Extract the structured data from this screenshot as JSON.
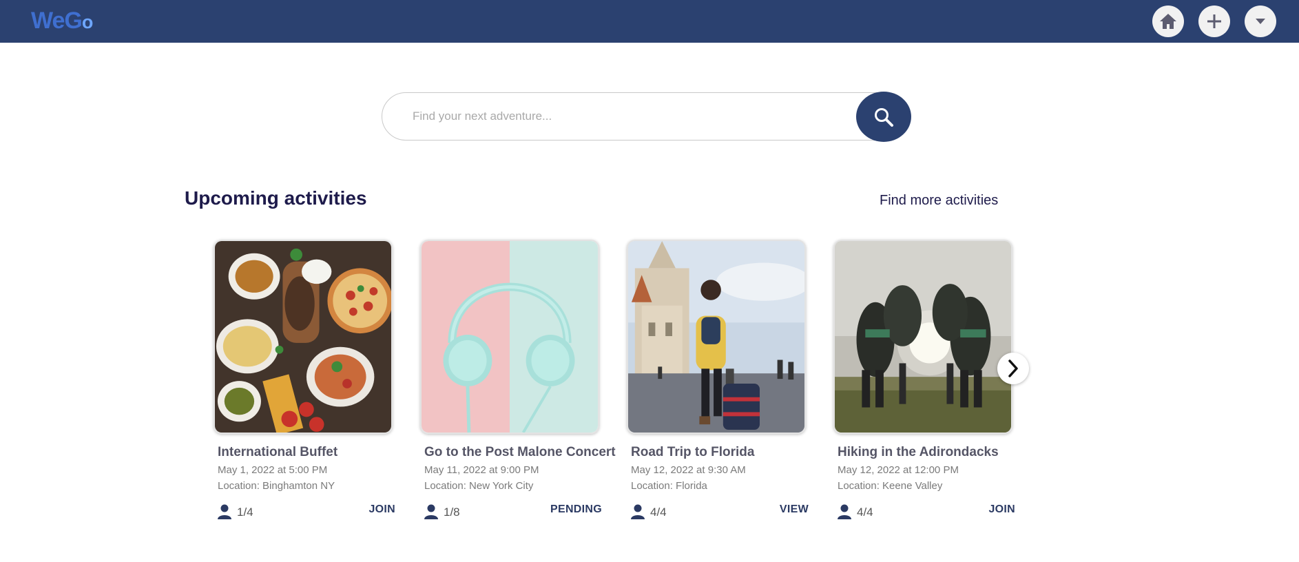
{
  "header": {
    "logo": {
      "part1": "We",
      "part2": "G",
      "part3": "o"
    },
    "home_icon": "home-icon",
    "add_icon": "plus-icon",
    "menu_icon": "caret-down-icon"
  },
  "search": {
    "placeholder": "Find your next adventure...",
    "value": "",
    "button_icon": "search-icon"
  },
  "section": {
    "title": "Upcoming activities",
    "find_more": "Find more activities"
  },
  "activities": [
    {
      "title": "International Buffet",
      "date": "May 1, 2022 at 5:00 PM",
      "location": "Location: Binghamton NY",
      "attendees": "1/4",
      "action": "JOIN",
      "image": "food-table-photo"
    },
    {
      "title": "Go to the Post Malone Concert",
      "date": "May 11, 2022 at 9:00 PM",
      "location": "Location: New York City",
      "attendees": "1/8",
      "action": "PENDING",
      "image": "headphones-photo"
    },
    {
      "title": "Road Trip to Florida",
      "date": "May 12, 2022 at 9:30 AM",
      "location": "Location: Florida",
      "attendees": "4/4",
      "action": "VIEW",
      "image": "traveler-suitcase-photo"
    },
    {
      "title": "Hiking in the Adirondacks",
      "date": "May 12, 2022 at 12:00 PM",
      "location": "Location: Keene Valley",
      "attendees": "4/4",
      "action": "JOIN",
      "image": "group-huddle-photo"
    }
  ],
  "carousel": {
    "next_icon": "chevron-right-icon"
  },
  "colors": {
    "navbar": "#2b4170",
    "title": "#1e1b4b",
    "action": "#2b3a63"
  }
}
